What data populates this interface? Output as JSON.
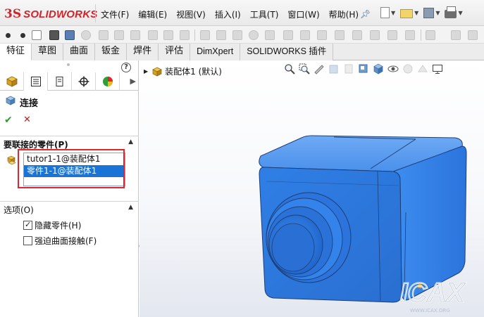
{
  "app": {
    "logo_prefix": "3S",
    "logo_name": "SOLIDWORKS"
  },
  "menu": [
    "文件(F)",
    "编辑(E)",
    "视图(V)",
    "插入(I)",
    "工具(T)",
    "窗口(W)",
    "帮助(H)"
  ],
  "tabs": [
    {
      "label": "特征",
      "active": true
    },
    {
      "label": "草图",
      "active": false
    },
    {
      "label": "曲面",
      "active": false
    },
    {
      "label": "钣金",
      "active": false
    },
    {
      "label": "焊件",
      "active": false
    },
    {
      "label": "评估",
      "active": false
    },
    {
      "label": "DimXpert",
      "active": false
    },
    {
      "label": "SOLIDWORKS 插件",
      "active": false
    }
  ],
  "property_manager": {
    "title": "连接",
    "help_symbol": "?",
    "ok_symbol": "✔",
    "cancel_symbol": "✕",
    "parts_group_label": "要联接的零件(P)",
    "parts": [
      {
        "label": "tutor1-1@装配体1",
        "selected": false
      },
      {
        "label": "零件1-1@装配体1",
        "selected": true
      }
    ],
    "options_group_label": "选项(O)",
    "options": [
      {
        "label": "隐藏零件(H)",
        "checked": true
      },
      {
        "label": "强迫曲面接触(F)",
        "checked": false
      }
    ]
  },
  "graphics": {
    "tree_item": "装配体1 (默认)",
    "model_color": "#3f8eea",
    "watermark": "ICAX",
    "watermark_url": "WWW.ICAX.ORG"
  },
  "colors": {
    "selection": "#1a74d6",
    "highlight_box": "#e0262c",
    "brand": "#d2232a"
  }
}
